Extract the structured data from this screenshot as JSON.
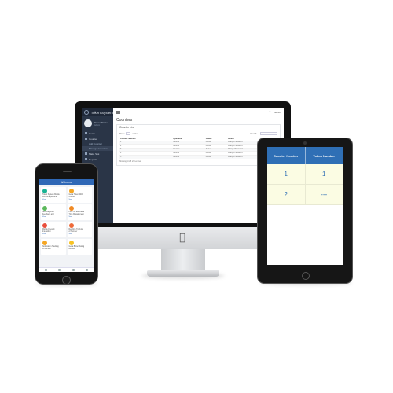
{
  "desktop": {
    "app_title": "Token System",
    "profile": {
      "name": "Token Master",
      "status": "Admin"
    },
    "nav": [
      {
        "label": "Home",
        "icon": "home-icon"
      },
      {
        "label": "Counter",
        "icon": "counter-icon"
      },
      {
        "label": "Add Counter",
        "sub": true
      },
      {
        "label": "Manage Counters",
        "sub": true,
        "active": true
      },
      {
        "label": "Make Slot",
        "icon": "slot-icon"
      },
      {
        "label": "Reports",
        "icon": "reports-icon"
      }
    ],
    "topbar": {
      "help": "?",
      "user": "Admin"
    },
    "page_title": "Counters",
    "panel_title": "Counter List",
    "controls": {
      "show": "Show",
      "entries": "entries",
      "search": "Search:"
    },
    "table": {
      "headers": [
        "Counter Number",
        "Operation",
        "Status",
        "Action"
      ],
      "rows": [
        [
          "1",
          "Counter",
          "Active",
          "Change Password"
        ],
        [
          "2",
          "Counter",
          "Active",
          "Change Password"
        ],
        [
          "3",
          "Counter",
          "Active",
          "Change Password"
        ],
        [
          "4",
          "Counter",
          "Active",
          "Change Password"
        ],
        [
          "5",
          "Counter",
          "Active",
          "Change Password"
        ]
      ],
      "info": "Showing 1 to 5 of 5 entries"
    },
    "accent": "#2a3547"
  },
  "mobile": {
    "header_title": "Welcome",
    "cards": [
      {
        "lines": [
          "Token System Mobile",
          "With Analysis and",
          "Prediction"
        ],
        "badge": "View",
        "color": "#19b394"
      },
      {
        "lines": [
          "Get a Token With",
          "Counter"
        ],
        "badge": "View",
        "color": "#f5a623"
      },
      {
        "lines": [
          "Self Diagnosis",
          "Feedback and",
          "Prediction"
        ],
        "badge": "View",
        "color": "#5cb85c"
      },
      {
        "lines": [
          "Find Out Estimated",
          "Time Management"
        ],
        "badge": "View",
        "color": "#f08a24"
      },
      {
        "lines": [
          "Mobile Friendly",
          "Interaction"
        ],
        "badge": "View",
        "color": "#e94e3c"
      },
      {
        "lines": [
          "Realtime Tracking",
          "of Number"
        ],
        "badge": "View",
        "color": "#ef6b3a"
      },
      {
        "lines": [
          "Notification Tracking",
          "of Number"
        ],
        "badge": "View",
        "color": "#f5a623"
      },
      {
        "lines": [
          "Get a Better Rating",
          "Review"
        ],
        "badge": "View",
        "color": "#f7c325"
      }
    ],
    "header_color": "#2f68b6"
  },
  "tablet": {
    "headers": [
      "Counter Number",
      "Token Number"
    ],
    "rows": [
      [
        "1",
        "1"
      ],
      [
        "2",
        "---"
      ]
    ],
    "header_color": "#2f6fb5",
    "row_color": "#fbfce3"
  }
}
